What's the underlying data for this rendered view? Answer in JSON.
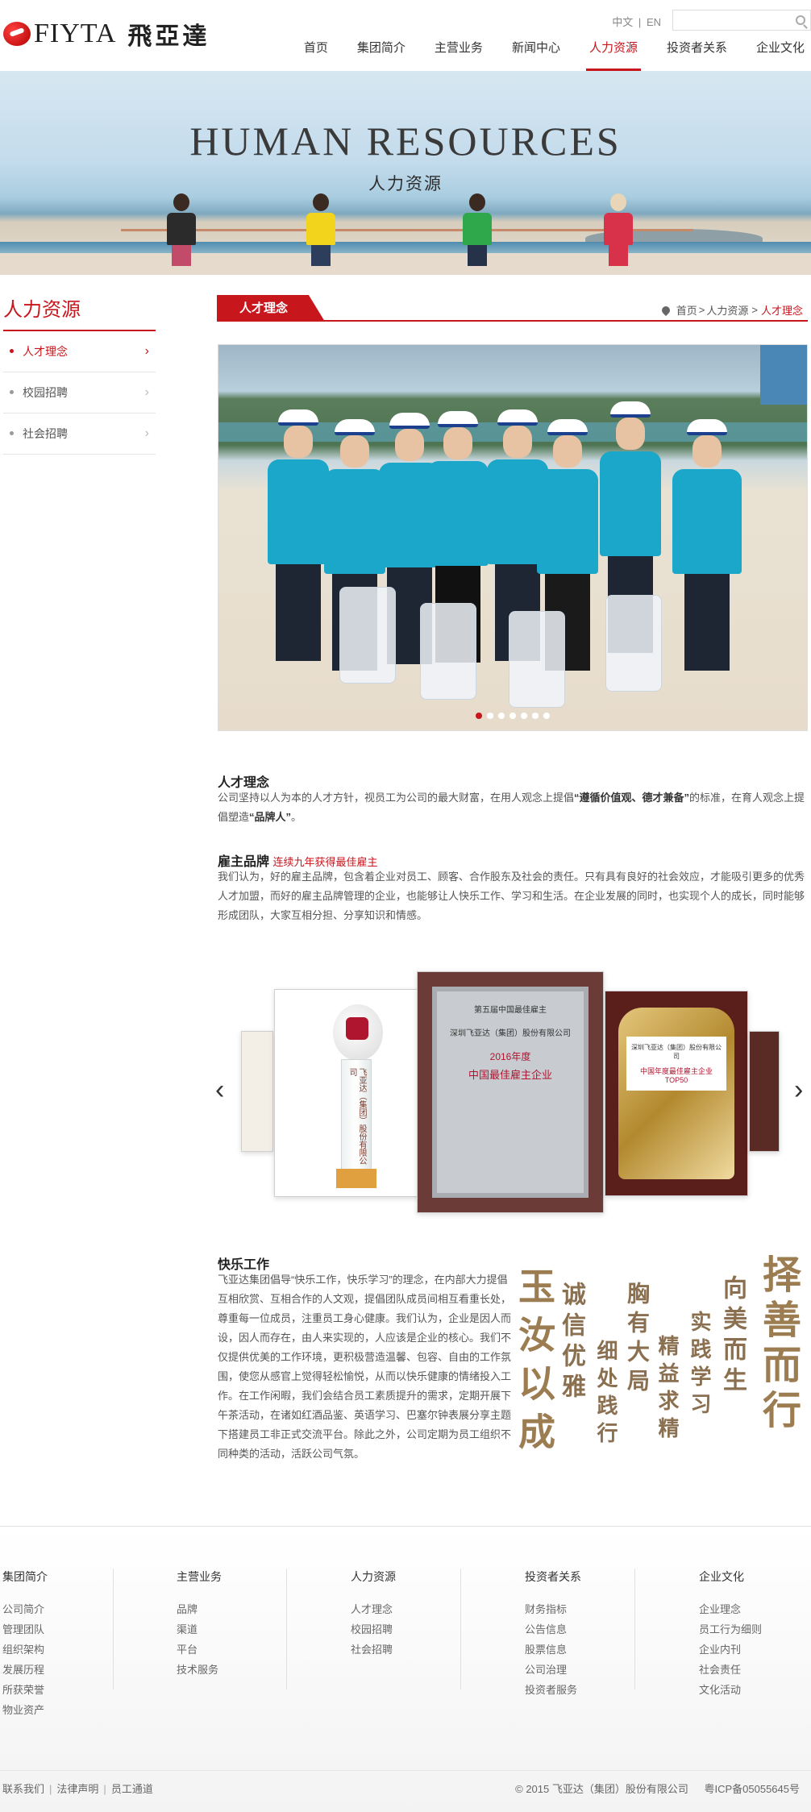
{
  "brand": {
    "name": "FIYTA",
    "name_cn": "飛亞達"
  },
  "lang": {
    "cn": "中文",
    "sep": "|",
    "en": "EN"
  },
  "search": {
    "placeholder": ""
  },
  "nav": [
    "首页",
    "集团简介",
    "主营业务",
    "新闻中心",
    "人力资源",
    "投资者关系",
    "企业文化"
  ],
  "banner": {
    "title": "HUMAN RESOURCES",
    "subtitle": "人力资源"
  },
  "sidebar": {
    "title": "人力资源",
    "items": [
      {
        "label": "人才理念",
        "active": true
      },
      {
        "label": "校园招聘",
        "active": false
      },
      {
        "label": "社会招聘",
        "active": false
      }
    ]
  },
  "section": {
    "tab": "人才理念",
    "breadcrumb": {
      "home": "首页",
      "sep1": ">",
      "parent": "人力资源",
      "sep2": ">",
      "current": "人才理念"
    }
  },
  "slider": {
    "dot_count": 7,
    "active_index": 0
  },
  "talent": {
    "title": "人才理念",
    "text_a": "公司坚持以人为本的人才方针，视员工为公司的最大财富，在用人观念上提倡",
    "bold_a": "“遵循价值观、德才兼备”",
    "text_b": "的标准，在育人观念上提倡塑造",
    "bold_b": "“品牌人”",
    "text_c": "。"
  },
  "employer": {
    "title": "雇主品牌",
    "highlight": "连续九年获得最佳雇主",
    "text": "我们认为，好的雇主品牌，包含着企业对员工、顾客、合作股东及社会的责任。只有具有良好的社会效应，才能吸引更多的优秀人才加盟，而好的雇主品牌管理的企业，也能够让人快乐工作、学习和生活。在企业发展的同时，也实现个人的成长，同时能够形成团队，大家互相分担、分享知识和情感。"
  },
  "awards": {
    "prev": "‹",
    "next": "›",
    "plaque_main": {
      "line1": "第五届中国最佳雇主",
      "line2": "深圳飞亚达（集团）股份有限公司",
      "line3": "2016年度",
      "line4": "中国最佳雇主企业"
    },
    "plaque_gold": {
      "line1": "深圳飞亚达（集团）股份有限公司",
      "line2": "中国年度最佳雇主企业TOP50"
    },
    "trophy": {
      "text": "飞亚达（集团）股份有限公司"
    }
  },
  "happy": {
    "title": "快乐工作",
    "text": "飞亚达集团倡导“快乐工作，快乐学习”的理念，在内部大力提倡互相欣赏、互相合作的人文观，提倡团队成员间相互看重长处，尊重每一位成员，注重员工身心健康。我们认为，企业是因人而设，因人而存在，由人来实现的，人应该是企业的核心。我们不仅提供优美的工作环境，更积极营造温馨、包容、自由的工作氛围，使您从感官上觉得轻松愉悦，从而以快乐健康的情绪投入工作。在工作闲暇，我们会结合员工素质提升的需求，定期开展下午茶活动，在诸如红酒品鉴、英语学习、巴塞尔钟表展分享主题下搭建员工非正式交流平台。除此之外，公司定期为员工组织不同种类的活动，活跃公司气氛。"
  },
  "calligraphy": [
    "择善而行",
    "向美而生",
    "实践学习",
    "精益求精",
    "胸有大局",
    "细处践行",
    "诚信优雅",
    "玉汝以成"
  ],
  "footer": {
    "columns": [
      {
        "title": "集团简介",
        "links": [
          "公司简介",
          "管理团队",
          "组织架构",
          "发展历程",
          "所获荣誉",
          "物业资产"
        ]
      },
      {
        "title": "主营业务",
        "links": [
          "品牌",
          "渠道",
          "平台",
          "技术服务"
        ]
      },
      {
        "title": "人力资源",
        "links": [
          "人才理念",
          "校园招聘",
          "社会招聘"
        ]
      },
      {
        "title": "投资者关系",
        "links": [
          "财务指标",
          "公告信息",
          "股票信息",
          "公司治理",
          "投资者服务"
        ]
      },
      {
        "title": "企业文化",
        "links": [
          "企业理念",
          "员工行为细则",
          "企业内刊",
          "社会责任",
          "文化活动"
        ]
      }
    ],
    "bottom_links": [
      "联系我们",
      "法律声明",
      "员工通道"
    ],
    "bottom_sep": "|",
    "copyright": "© 2015 飞亚达（集团）股份有限公司",
    "icp": "粤ICP备05055645号"
  },
  "colors": {
    "accent": "#c8161d",
    "text": "#333333",
    "muted": "#666666",
    "shirt": "#1ba7c9",
    "gold": "#8a7050"
  }
}
